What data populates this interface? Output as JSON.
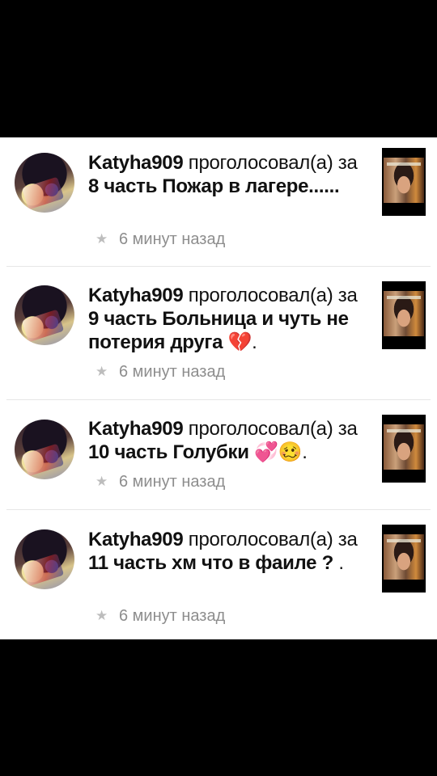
{
  "feed": {
    "items": [
      {
        "user": "Katyha909",
        "verb": "проголосовал(а)",
        "prep": "за",
        "part": "8 часть Пожар в лагере......",
        "emoji": "",
        "time": "6 минут назад"
      },
      {
        "user": "Katyha909",
        "verb": "проголосовал(а)",
        "prep": "за",
        "part": "9 часть Больница и чуть не потерия друга",
        "emoji": "💔.",
        "time": "6 минут назад"
      },
      {
        "user": "Katyha909",
        "verb": "проголосовал(а)",
        "prep": "за",
        "part": "10 часть Голубки",
        "emoji": "💞🥴.",
        "time": "6 минут назад"
      },
      {
        "user": "Katyha909",
        "verb": "проголосовал(а)",
        "prep": "за",
        "part": "11 часть хм что в фаиле ?",
        "emoji": ".",
        "time": "6 минут назад"
      }
    ]
  },
  "icons": {
    "time_icon": "star-icon"
  },
  "colors": {
    "background": "#ffffff",
    "letterbox": "#000000",
    "primary_text": "#111111",
    "secondary_text": "#8d8d8d",
    "divider": "#e6e6e6"
  }
}
